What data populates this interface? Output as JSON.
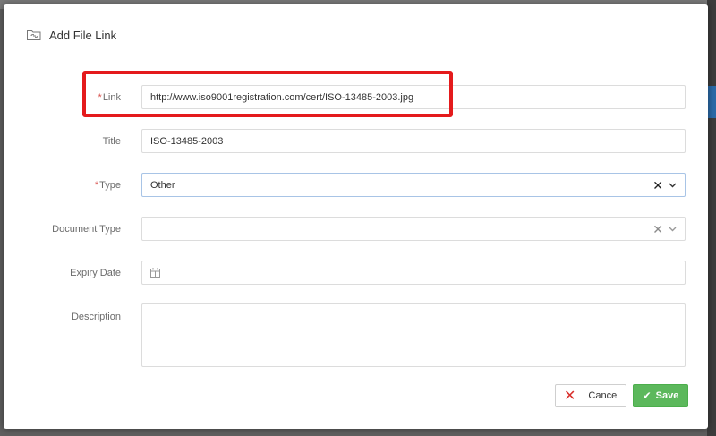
{
  "dialog": {
    "title": "Add File Link",
    "icon": "folder-link-icon"
  },
  "form": {
    "link": {
      "label": "Link",
      "required_marker": "*",
      "value": "http://www.iso9001registration.com/cert/ISO-13485-2003.jpg"
    },
    "title": {
      "label": "Title",
      "value": "ISO-13485-2003"
    },
    "type": {
      "label": "Type",
      "required_marker": "*",
      "value": "Other",
      "clear_glyph": "✕"
    },
    "document_type": {
      "label": "Document Type",
      "value": "",
      "clear_glyph": "✕"
    },
    "expiry_date": {
      "label": "Expiry Date",
      "value": ""
    },
    "description": {
      "label": "Description",
      "value": ""
    }
  },
  "actions": {
    "cancel_label": "Cancel",
    "cancel_icon_glyph": "✕",
    "save_label": "Save",
    "save_icon_glyph": "✔"
  },
  "colors": {
    "highlight": "#e41a1c",
    "required": "#d9534f",
    "save": "#5cb85c",
    "cancel_icon": "#d9302c"
  }
}
